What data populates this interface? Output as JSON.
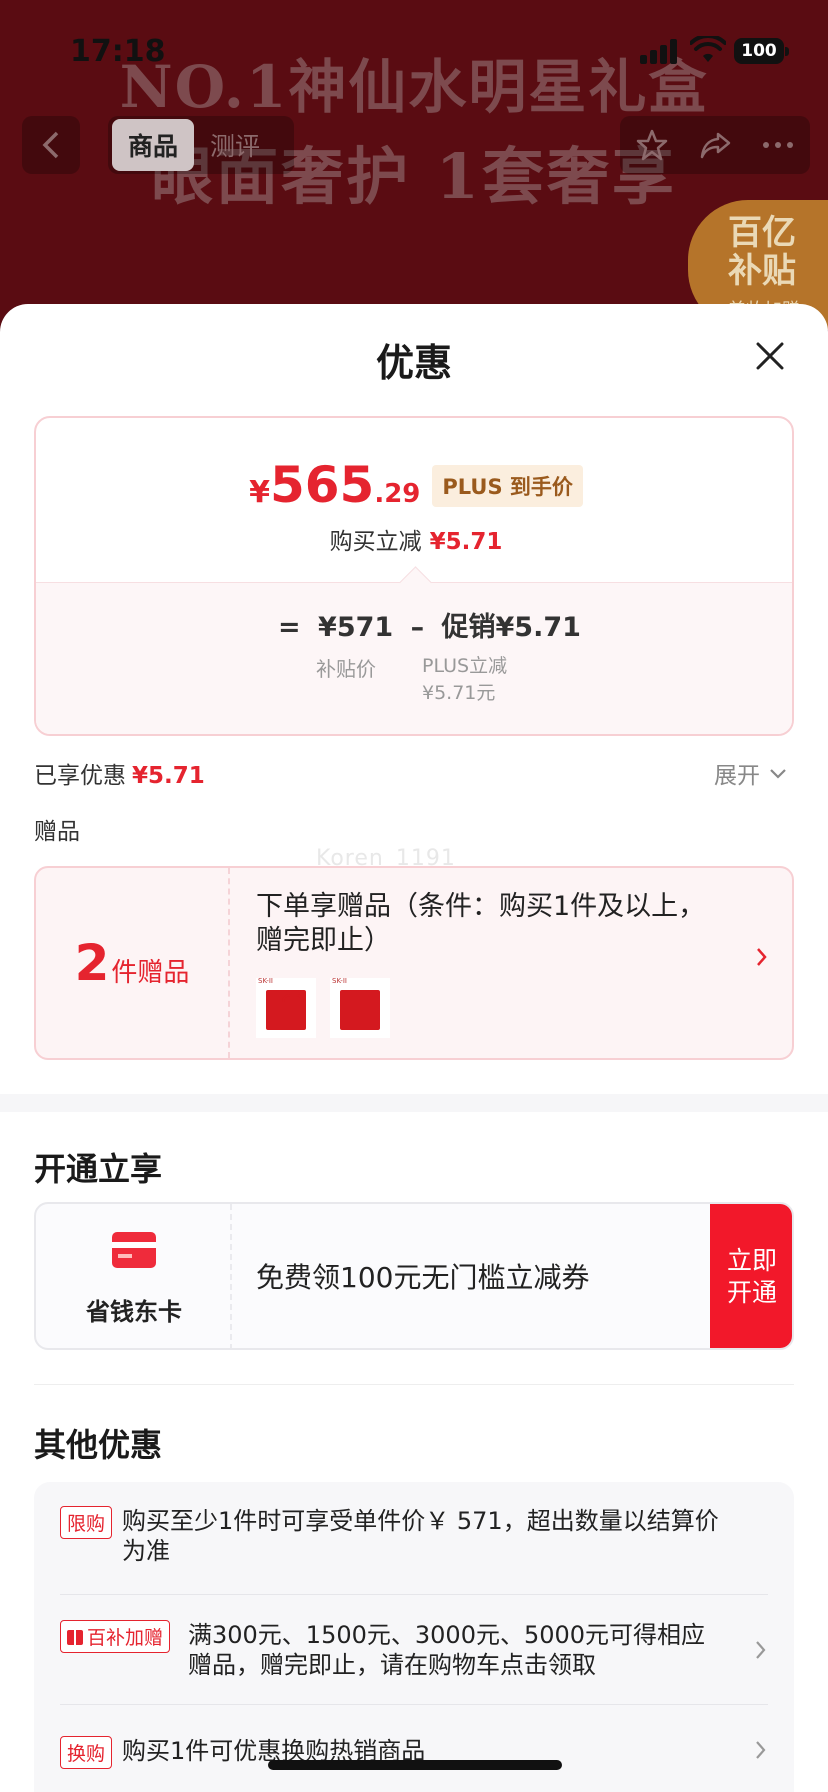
{
  "status_bar": {
    "time": "17:18",
    "battery": "100"
  },
  "background": {
    "banner_line1": "NO.1神仙水明星礼盒",
    "banner_line2": "眼面奢护 1套奢享",
    "tabs": [
      "商品",
      "测评"
    ],
    "subsidy_badge": {
      "line1": "百亿",
      "line2": "补贴",
      "line3": "美妆加赠"
    }
  },
  "sheet": {
    "title": "优惠",
    "price": {
      "symbol": "¥",
      "integer": "565",
      "decimal": ".29",
      "plus_tag": "PLUS 到手价"
    },
    "reduce": {
      "label": "购买立减",
      "value": "¥5.71"
    },
    "formula": {
      "eq": "=",
      "base": "¥571",
      "minus": "–",
      "promo": "促销¥5.71",
      "base_label": "补贴价",
      "promo_label_line1": "PLUS立减",
      "promo_label_line2": "¥5.71元"
    },
    "enjoyed": {
      "label": "已享优惠",
      "value": "¥5.71"
    },
    "expand_label": "展开",
    "gift_heading": "赠品",
    "watermark": "Koren_1191",
    "gift_card": {
      "count": "2",
      "count_unit": "件赠品",
      "desc": "下单享赠品（条件：购买1件及以上，赠完即止）",
      "item_labels": [
        "SK-II",
        "SK-II"
      ]
    },
    "open_section": {
      "heading": "开通立享",
      "card_name": "省钱东卡",
      "offer": "免费领100元无门槛立减券",
      "button": "立即开通"
    },
    "other_section": {
      "heading": "其他优惠",
      "promos": [
        {
          "tag": "限购",
          "text": "购买至少1件时可享受单件价￥ 571，超出数量以结算价为准"
        },
        {
          "tag": "百补加赠",
          "text": "满300元、1500元、3000元、5000元可得相应赠品，赠完即止，请在购物车点击领取"
        },
        {
          "tag": "换购",
          "text": "购买1件可优惠换购热销商品"
        }
      ]
    }
  },
  "colors": {
    "accent_red": "#e5242f",
    "plus_gold": "#9a5a1d",
    "open_button": "#f2182a"
  }
}
